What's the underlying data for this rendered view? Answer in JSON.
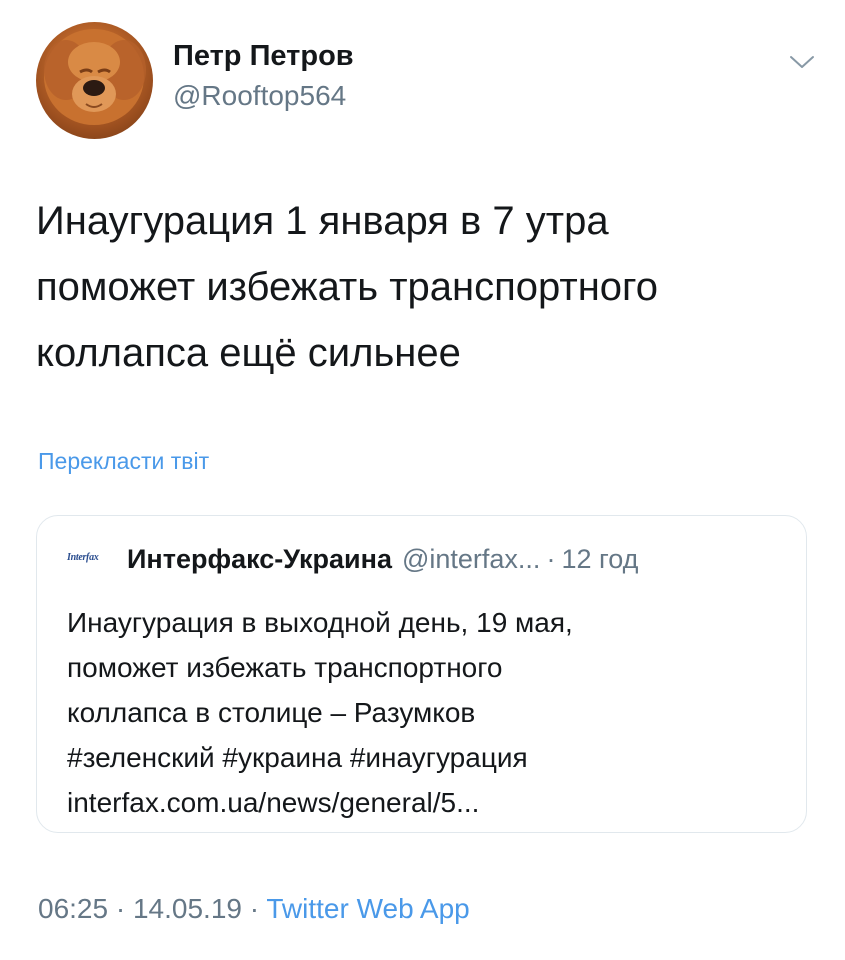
{
  "author": {
    "display_name": "Петр Петров",
    "handle": "@Rooftop564"
  },
  "tweet": {
    "lines": [
      "Инаугурация 1 января в 7 утра",
      "поможет избежать транспортного",
      "коллапса ещё сильнее"
    ],
    "translate_label": "Перекласти твіт"
  },
  "quote": {
    "logo_text": "Interfax",
    "name": "Интерфакс-Украина",
    "handle": "@interfax...",
    "separator": "·",
    "time": "12 год",
    "lines": [
      "Инаугурация в выходной день, 19 мая,",
      "поможет избежать транспортного",
      "коллапса в столице – Разумков",
      "#зеленский #украина #инаугурация",
      "interfax.com.ua/news/general/5..."
    ]
  },
  "footer": {
    "time": "06:25",
    "sep1": "·",
    "date": "14.05.19",
    "sep2": "·",
    "source": "Twitter Web App"
  },
  "icons": {
    "menu": "chevron-down-icon"
  },
  "colors": {
    "link": "#4a99e9",
    "secondary_text": "#657786",
    "primary_text": "#14171a",
    "border": "#e1e8ed"
  }
}
